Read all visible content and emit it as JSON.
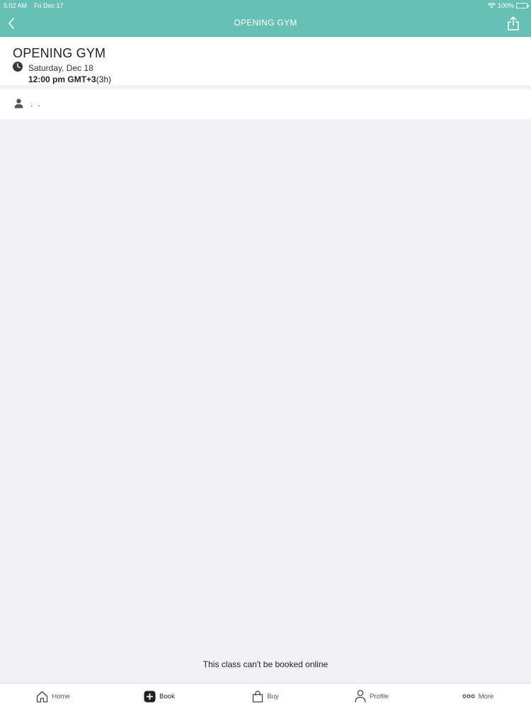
{
  "status_bar": {
    "time": "5:02 AM",
    "date": "Fri Dec 17",
    "battery": "100%"
  },
  "nav": {
    "title": "OPENING GYM"
  },
  "class_info": {
    "title": "OPENING GYM",
    "date": "Saturday, Dec 18",
    "time": "12:00 pm GMT+3",
    "duration": "(3h)"
  },
  "instructor": {
    "name": ". ."
  },
  "notice": "This class can't be booked online",
  "tabs": [
    {
      "label": "Home",
      "icon": "home-icon"
    },
    {
      "label": "Book",
      "icon": "plus-square-icon"
    },
    {
      "label": "Buy",
      "icon": "shopping-bag-icon"
    },
    {
      "label": "Profile",
      "icon": "person-icon"
    },
    {
      "label": "More",
      "icon": "more-dots-icon"
    }
  ],
  "colors": {
    "header": "#66c0b3",
    "background": "#f2f2f7"
  }
}
